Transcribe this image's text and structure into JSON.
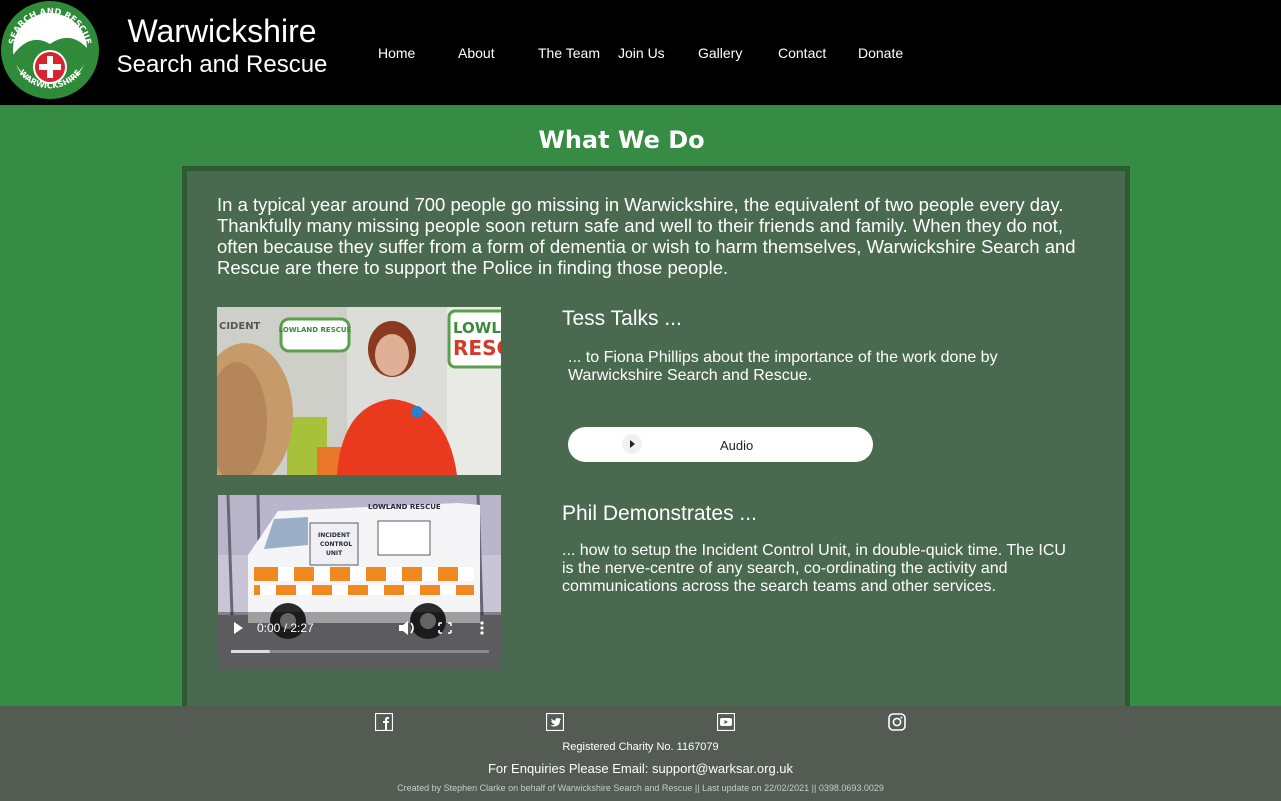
{
  "header": {
    "logo_text_top": "SEARCH AND RESCUE",
    "logo_text_bottom": "WARWICKSHIRE",
    "title_line1": "Warwickshire",
    "title_line2": "Search and Rescue",
    "nav": [
      "Home",
      "About",
      "The Team",
      "Join Us",
      "Gallery",
      "Contact",
      "Donate"
    ]
  },
  "main": {
    "heading": "What We Do",
    "intro": "In a typical year around 700 people go missing in Warwickshire, the equivalent of two people every day. Thankfully many missing people soon return safe and well to their friends and family. When they do not, often because they suffer from a form of dementia or wish to harm themselves, Warwickshire Search and Rescue are there to support the Police in finding those people.",
    "items": [
      {
        "title": "Tess Talks ...",
        "description": "... to Fiona Phillips about the importance of the work done by Warwickshire Search and Rescue.",
        "player_label": "Audio",
        "image_text": [
          "LOWLAND RESCUE",
          "LOWLA",
          "RESC",
          "CIDENT"
        ]
      },
      {
        "title": "Phil Demonstrates ...",
        "description": "... how to setup the Incident Control Unit, in double-quick time. The ICU is the nerve-centre of any search, co-ordinating the activity and communications across the search teams and other services.",
        "video_time": "0:00 / 2:27",
        "video_progress": 0.15,
        "image_text": [
          "LOWLAND RESCUE",
          "INCIDENT",
          "CONTROL",
          "UNIT"
        ]
      }
    ]
  },
  "footer": {
    "social": [
      "facebook-icon",
      "twitter-icon",
      "youtube-icon",
      "instagram-icon"
    ],
    "charity": "Registered Charity No. 1167079",
    "enquiries": "For Enquiries Please Email: support@warksar.org.uk",
    "credits": "Created by Stephen Clarke on behalf of Warwickshire Search and Rescue || Last update on 22/02/2021 || 0398.0693.0029"
  },
  "colors": {
    "page_bg": "#368c42",
    "panel_bg": "#4a6a50",
    "footer_bg": "#535b53",
    "header_bg": "#000000"
  }
}
